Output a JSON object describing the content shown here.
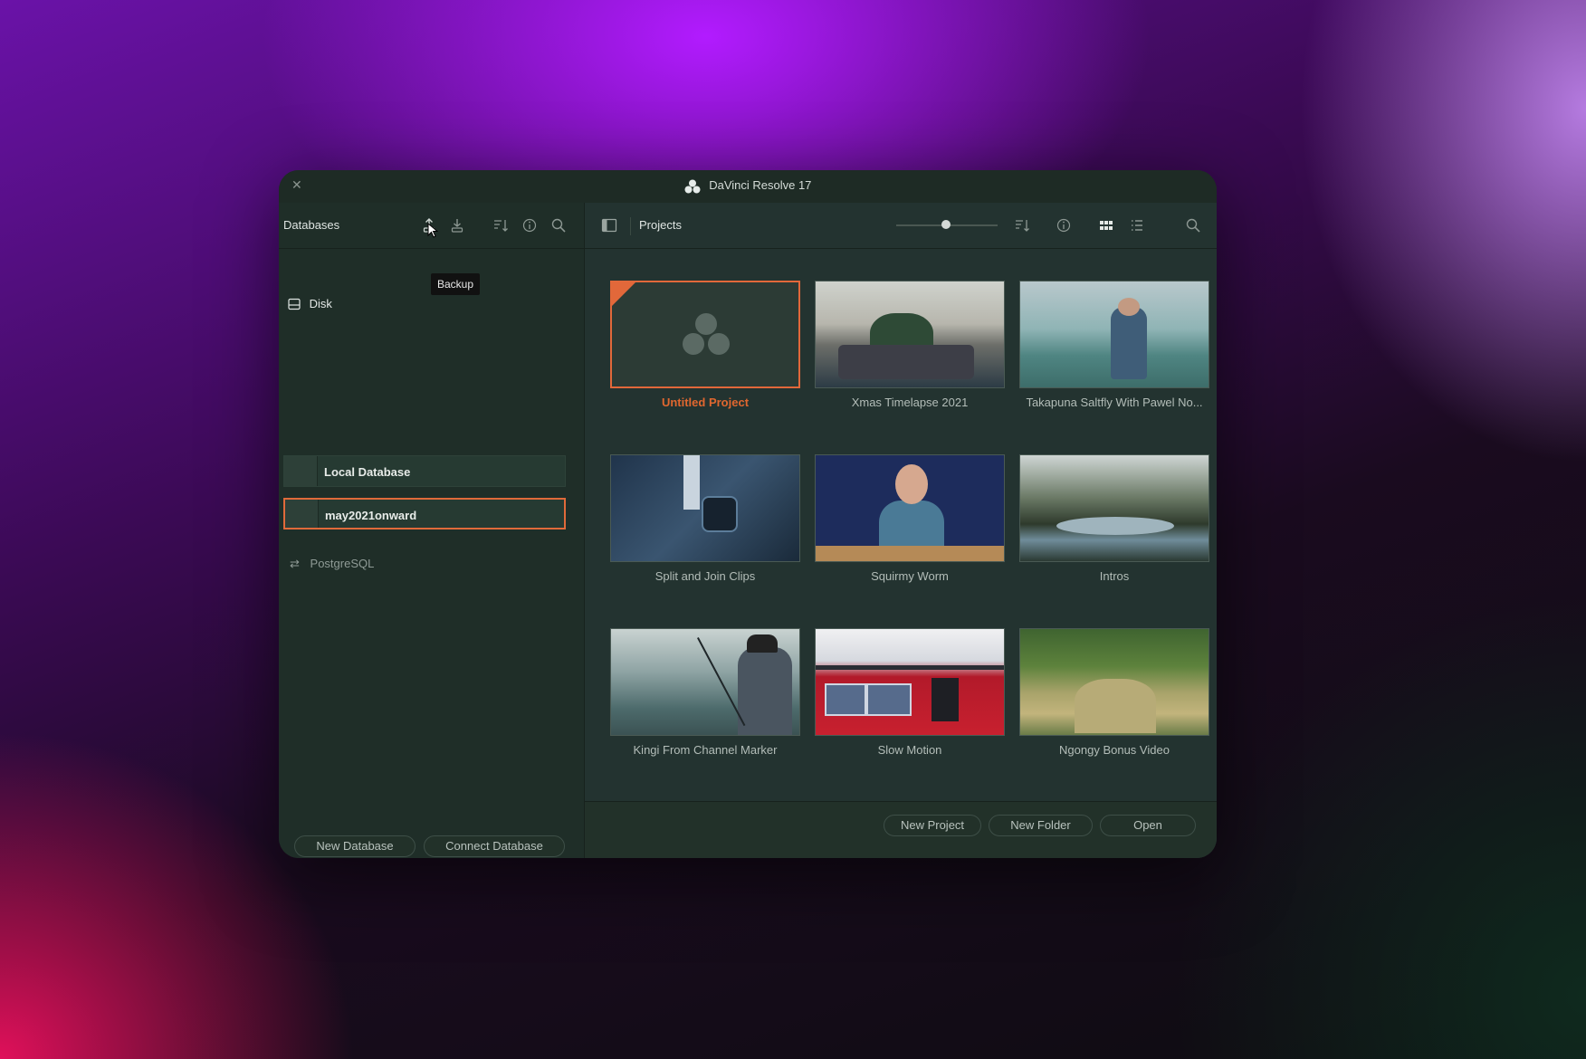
{
  "window": {
    "title": "DaVinci Resolve 17"
  },
  "databases": {
    "header": "Databases",
    "tooltip": "Backup",
    "disk_label": "Disk",
    "items": [
      {
        "name": "Local Database",
        "selected": false
      },
      {
        "name": "may2021onward",
        "selected": true
      }
    ],
    "postgres_label": "PostgreSQL",
    "new_database": "New Database",
    "connect_database": "Connect Database"
  },
  "projects": {
    "header": "Projects",
    "cards": [
      {
        "title": "Untitled Project",
        "selected": true,
        "thumb": "resolve-logo"
      },
      {
        "title": "Xmas Timelapse 2021",
        "thumb": "living-room"
      },
      {
        "title": "Takapuna Saltfly With Pawel No...",
        "thumb": "sea-fisherman"
      },
      {
        "title": "Split and Join Clips",
        "thumb": "smartwatch"
      },
      {
        "title": "Squirmy Worm",
        "thumb": "man-blue-wall"
      },
      {
        "title": "Intros",
        "thumb": "river-trees"
      },
      {
        "title": "Kingi From Channel Marker",
        "thumb": "fishing-rod"
      },
      {
        "title": "Slow Motion",
        "thumb": "red-train"
      },
      {
        "title": "Ngongy Bonus Video",
        "thumb": "green-stream"
      }
    ],
    "new_project": "New Project",
    "new_folder": "New Folder",
    "open": "Open"
  },
  "colors": {
    "accent": "#e2683a",
    "bg": "#213029"
  }
}
